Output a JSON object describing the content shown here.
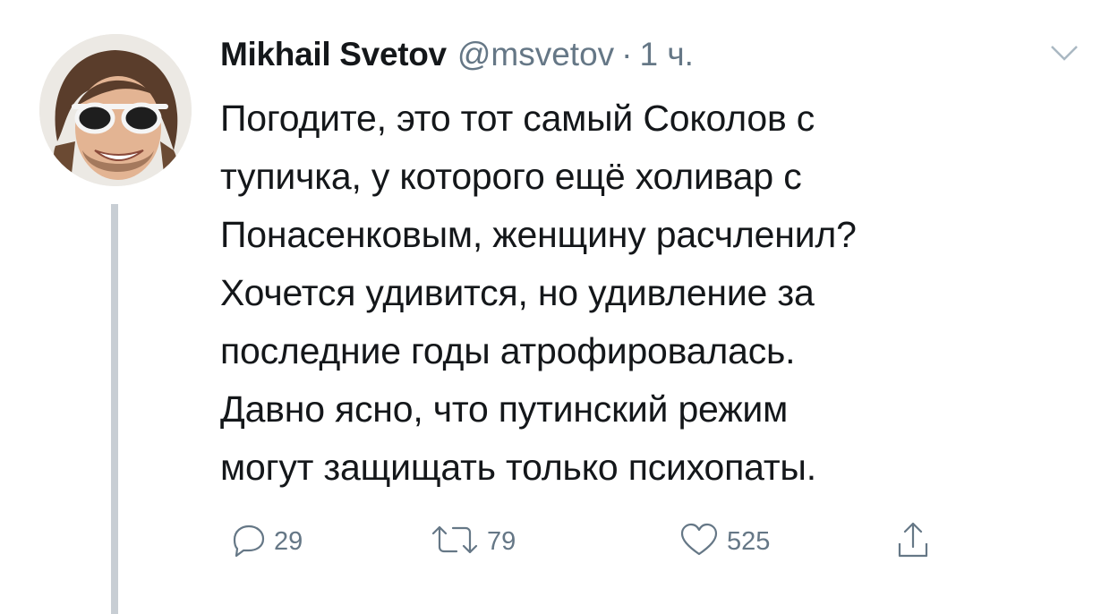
{
  "tweet": {
    "author_name": "Mikhail Svetov",
    "handle": "@msvetov",
    "separator": "·",
    "time": "1 ч.",
    "text_lines": [
      "Погодите, это тот самый Соколов с",
      "тупичка, у которого ещё холивар с",
      "Понасенковым, женщину расчленил?",
      "Хочется удивится, но удивление за",
      "последние годы атрофировалась.",
      "Давно ясно, что путинский режим",
      "могут защищать только психопаты."
    ],
    "actions": {
      "reply_count": "29",
      "retweet_count": "79",
      "like_count": "525"
    }
  },
  "icons": {
    "caret": "chevron-down-icon",
    "reply": "reply-icon",
    "retweet": "retweet-icon",
    "like": "heart-icon",
    "share": "share-icon"
  },
  "colors": {
    "text": "#14171a",
    "secondary": "#657786",
    "thread_line": "#c8ced4"
  }
}
